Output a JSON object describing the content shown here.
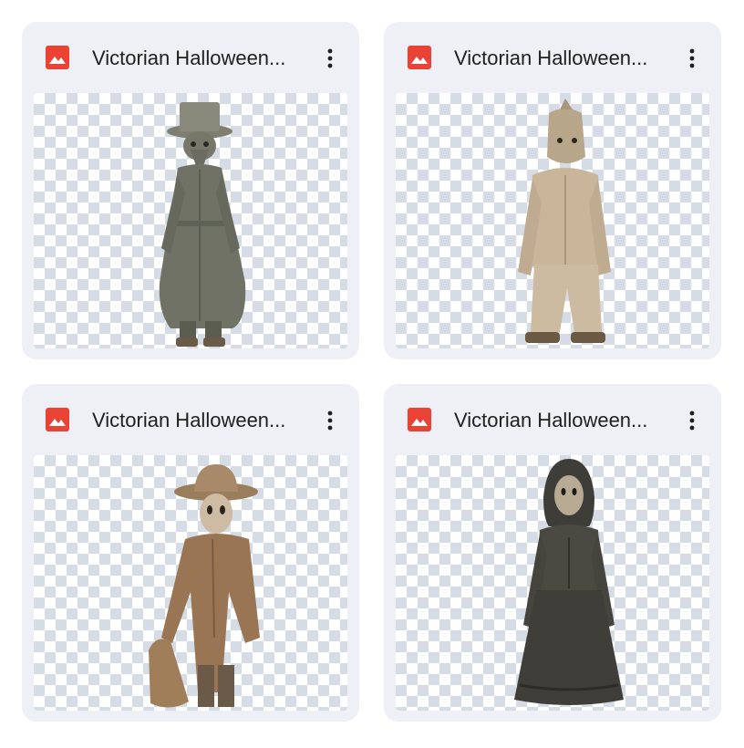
{
  "files": [
    {
      "name": "Victorian Halloween...",
      "type_icon": "image-file-icon",
      "menu_icon": "more-vert-icon",
      "thumbnail": "figure in grey coat with plague-doctor mask and top hat"
    },
    {
      "name": "Victorian Halloween...",
      "type_icon": "image-file-icon",
      "menu_icon": "more-vert-icon",
      "thumbnail": "figure in beige burlap suit with sack mask"
    },
    {
      "name": "Victorian Halloween...",
      "type_icon": "image-file-icon",
      "menu_icon": "more-vert-icon",
      "thumbnail": "figure in brown coat with wide hat and sack bag"
    },
    {
      "name": "Victorian Halloween...",
      "type_icon": "image-file-icon",
      "menu_icon": "more-vert-icon",
      "thumbnail": "figure in dark dress with hood and mask"
    }
  ],
  "colors": {
    "card_bg": "#eef0f6",
    "icon_red": "#ea4335",
    "text": "#1f1f1f",
    "checker": "#d6dce6"
  }
}
